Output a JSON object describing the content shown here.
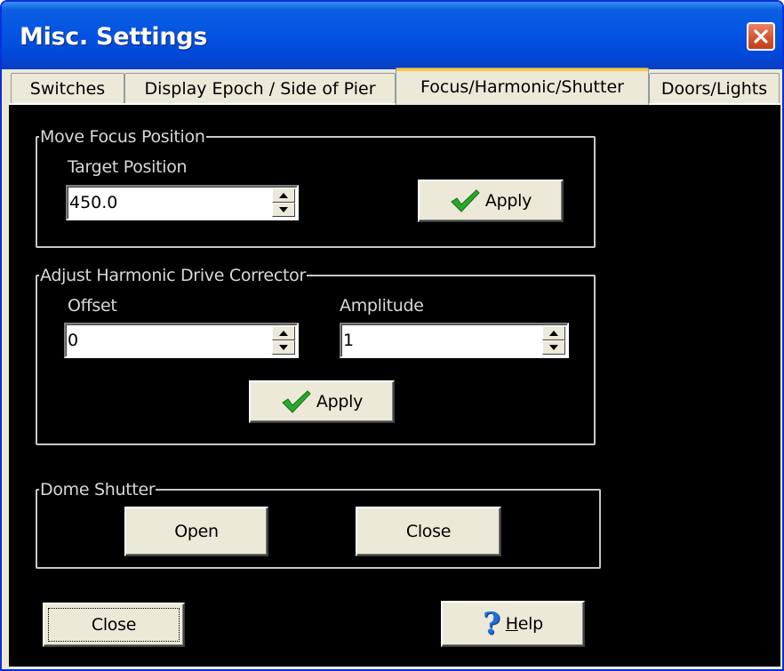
{
  "window": {
    "title": "Misc. Settings",
    "close_icon": "close-x-icon"
  },
  "tabs": [
    {
      "label": "Switches",
      "active": false
    },
    {
      "label": "Display Epoch / Side of Pier",
      "active": false
    },
    {
      "label": "Focus/Harmonic/Shutter",
      "active": true
    },
    {
      "label": "Doors/Lights",
      "active": false
    }
  ],
  "focus": {
    "group_label": "Move Focus Position",
    "target_label": "Target Position",
    "target_value": "450.0",
    "apply_label": "Apply"
  },
  "harmonic": {
    "group_label": "Adjust Harmonic Drive Corrector",
    "offset_label": "Offset",
    "offset_value": "0",
    "amplitude_label": "Amplitude",
    "amplitude_value": "1",
    "apply_label": "Apply"
  },
  "shutter": {
    "group_label": "Dome Shutter",
    "open_label": "Open",
    "close_label": "Close"
  },
  "footer": {
    "close_label": "Close",
    "help_icon": "question-mark-icon",
    "help_label_underlined": "H",
    "help_label_rest": "elp"
  },
  "colors": {
    "panel_background": "#000000",
    "titlebar": "#0554e3",
    "checkmark": "#2aa82a",
    "help_icon": "#1f6fd8"
  }
}
